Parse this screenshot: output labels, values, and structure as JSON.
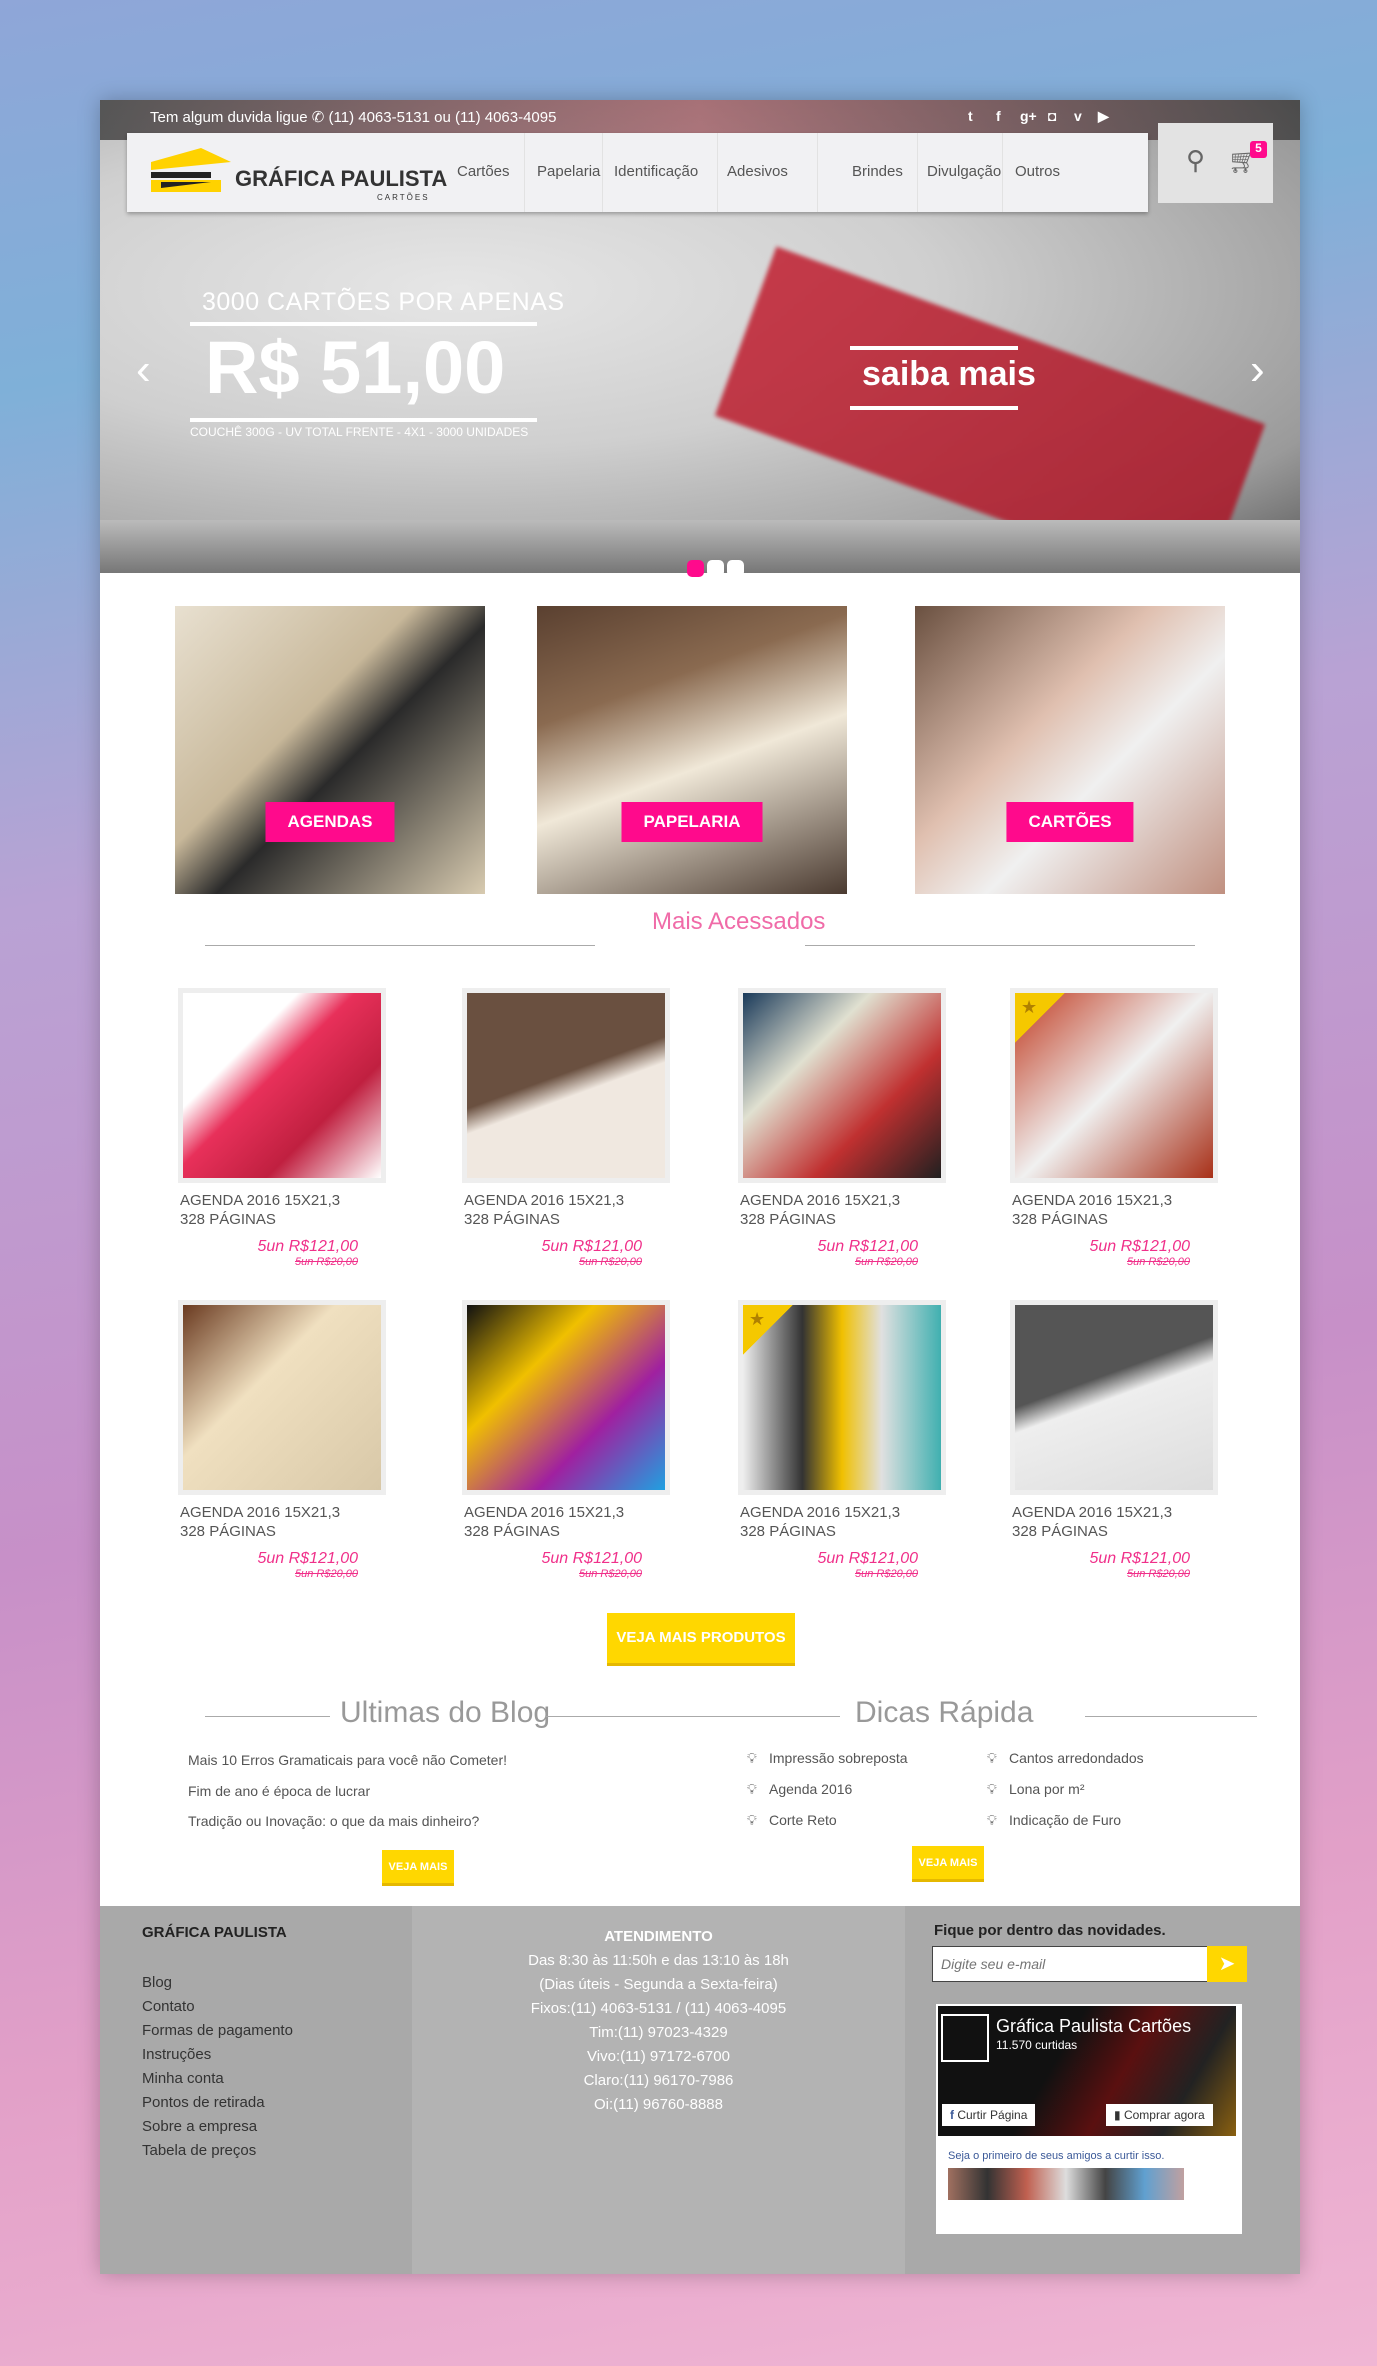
{
  "topbar": {
    "help": "Tem algum duvida ligue",
    "phones": "(11) 4063-5131 ou (11) 4063-4095",
    "social": [
      "twitter-icon",
      "facebook-icon",
      "google-plus-icon",
      "instagram-icon",
      "vimeo-icon",
      "youtube-icon"
    ]
  },
  "logo": {
    "name": "GRÁFICA PAULISTA",
    "sub": "CARTÕES"
  },
  "nav": [
    "Cartões",
    "Papelaria",
    "Identificação",
    "Adesivos",
    "Brindes",
    "Divulgação",
    "Outros"
  ],
  "cart": {
    "count": "5"
  },
  "hero": {
    "headline": "3000 CARTÕES POR APENAS",
    "price": "R$ 51,00",
    "details": "COUCHÊ 300G - UV TOTAL FRENTE - 4X1 - 3000 UNIDADES",
    "cta": "saiba mais",
    "slides": 3,
    "active_slide": 1
  },
  "categories": [
    "AGENDAS",
    "PAPELARIA",
    "CARTÕES"
  ],
  "most_accessed": {
    "title": "Mais Acessados",
    "products": [
      {
        "name1": "AGENDA 2016 15X21,3",
        "name2": "328 PÁGINAS",
        "price": "5un R$121,00",
        "old": "5un R$20,00",
        "featured": false
      },
      {
        "name1": "AGENDA 2016 15X21,3",
        "name2": "328 PÁGINAS",
        "price": "5un R$121,00",
        "old": "5un R$20,00",
        "featured": false
      },
      {
        "name1": "AGENDA 2016 15X21,3",
        "name2": "328 PÁGINAS",
        "price": "5un R$121,00",
        "old": "5un R$20,00",
        "featured": false
      },
      {
        "name1": "AGENDA 2016 15X21,3",
        "name2": "328 PÁGINAS",
        "price": "5un R$121,00",
        "old": "5un R$20,00",
        "featured": true
      },
      {
        "name1": "AGENDA 2016 15X21,3",
        "name2": "328 PÁGINAS",
        "price": "5un R$121,00",
        "old": "5un R$20,00",
        "featured": false
      },
      {
        "name1": "AGENDA 2016 15X21,3",
        "name2": "328 PÁGINAS",
        "price": "5un R$121,00",
        "old": "5un R$20,00",
        "featured": false
      },
      {
        "name1": "AGENDA 2016 15X21,3",
        "name2": "328 PÁGINAS",
        "price": "5un R$121,00",
        "old": "5un R$20,00",
        "featured": true
      },
      {
        "name1": "AGENDA 2016 15X21,3",
        "name2": "328 PÁGINAS",
        "price": "5un R$121,00",
        "old": "5un R$20,00",
        "featured": false
      }
    ],
    "more": "VEJA MAIS PRODUTOS"
  },
  "blog": {
    "title": "Ultimas do Blog",
    "items": [
      "Mais 10 Erros Gramaticais para você não Cometer!",
      "Fim de ano é época de lucrar",
      "Tradição ou Inovação: o que da mais dinheiro?"
    ],
    "more": "VEJA MAIS"
  },
  "tips": {
    "title": "Dicas Rápida",
    "items": [
      "Impressão sobreposta",
      "Agenda 2016",
      "Corte Reto",
      "Cantos arredondados",
      "Lona por m²",
      "Indicação de Furo"
    ],
    "more": "VEJA MAIS"
  },
  "footer": {
    "brand": "GRÁFICA PAULISTA",
    "links": [
      "Blog",
      "Contato",
      "Formas de pagamento",
      "Instruções",
      "Minha conta",
      "Pontos de retirada",
      "Sobre a empresa",
      "Tabela de preços"
    ],
    "service_title": "ATENDIMENTO",
    "service": [
      "Das 8:30 às 11:50h e das 13:10 às 18h",
      "(Dias úteis - Segunda a Sexta-feira)",
      "Fixos:(11) 4063-5131 / (11) 4063-4095",
      "Tim:(11) 97023-4329",
      "Vivo:(11) 97172-6700",
      "Claro:(11) 96170-7986",
      "Oi:(11) 96760-8888"
    ],
    "newsletter_title": "Fique por dentro das novidades.",
    "newsletter_placeholder": "Digite seu e-mail",
    "fb": {
      "page": "Gráfica Paulista Cartões",
      "likes": "11.570 curtidas",
      "like_btn": "Curtir Página",
      "shop_btn": "Comprar agora",
      "friends": "Seja o primeiro de seus amigos a curtir isso."
    }
  },
  "colors": {
    "accent": "#ff0a8c",
    "yellow": "#ffd700",
    "footer": "#a9a9a9"
  }
}
